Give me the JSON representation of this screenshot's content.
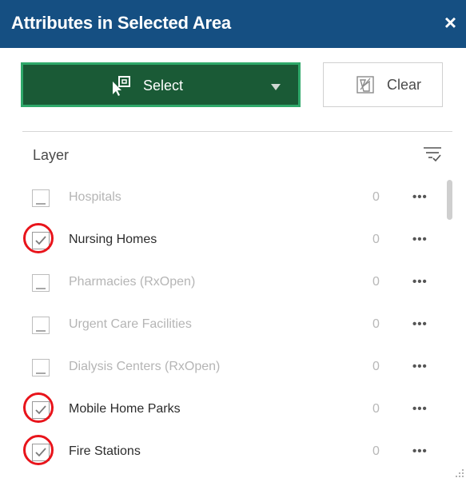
{
  "panel": {
    "title": "Attributes in Selected Area",
    "close_symbol": "×"
  },
  "toolbar": {
    "select_label": "Select",
    "select_icon": "select-area-icon",
    "clear_label": "Clear",
    "clear_icon": "clear-selection-icon"
  },
  "list_header": {
    "label": "Layer",
    "filter_icon": "filter-list-icon"
  },
  "colors": {
    "header_bg": "#154f82",
    "select_bg": "#1a5a36",
    "select_border": "#2fa86a",
    "highlight_ring": "#e8141b"
  },
  "layers": [
    {
      "name": "Hospitals",
      "count": "0",
      "checked": false,
      "enabled": false,
      "more": "•••"
    },
    {
      "name": "Nursing Homes",
      "count": "0",
      "checked": true,
      "enabled": true,
      "more": "•••"
    },
    {
      "name": "Pharmacies (RxOpen)",
      "count": "0",
      "checked": false,
      "enabled": false,
      "more": "•••"
    },
    {
      "name": "Urgent Care Facilities",
      "count": "0",
      "checked": false,
      "enabled": false,
      "more": "•••"
    },
    {
      "name": "Dialysis Centers (RxOpen)",
      "count": "0",
      "checked": false,
      "enabled": false,
      "more": "•••"
    },
    {
      "name": "Mobile Home Parks",
      "count": "0",
      "checked": true,
      "enabled": true,
      "more": "•••"
    },
    {
      "name": "Fire Stations",
      "count": "0",
      "checked": true,
      "enabled": true,
      "more": "•••"
    }
  ]
}
